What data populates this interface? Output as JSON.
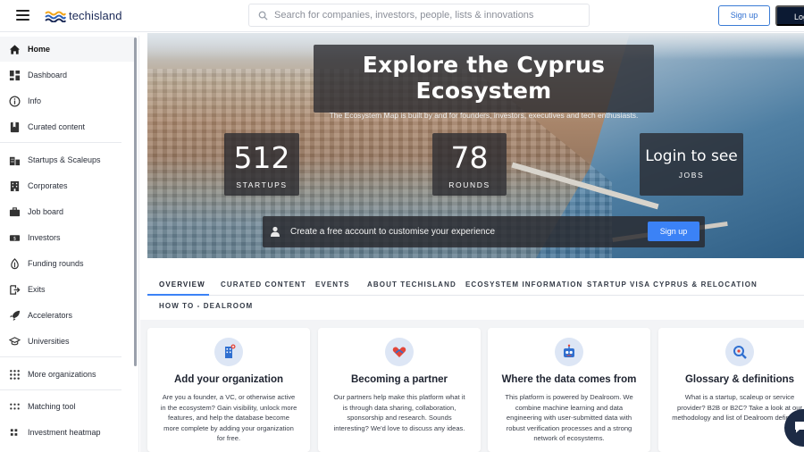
{
  "header": {
    "logo_text": "techisland",
    "search_placeholder": "Search for companies, investors, people, lists & innovations",
    "signup_label": "Sign up",
    "login_label": "Login"
  },
  "sidebar": {
    "items": [
      {
        "label": "Home",
        "icon": "home-icon"
      },
      {
        "label": "Dashboard",
        "icon": "dashboard-icon"
      },
      {
        "label": "Info",
        "icon": "info-icon"
      },
      {
        "label": "Curated content",
        "icon": "bookmark-icon"
      },
      {
        "label": "Startups & Scaleups",
        "icon": "building-icon"
      },
      {
        "label": "Corporates",
        "icon": "office-icon"
      },
      {
        "label": "Job board",
        "icon": "briefcase-icon"
      },
      {
        "label": "Investors",
        "icon": "money-icon"
      },
      {
        "label": "Funding rounds",
        "icon": "funding-icon"
      },
      {
        "label": "Exits",
        "icon": "exit-icon"
      },
      {
        "label": "Accelerators",
        "icon": "rocket-icon"
      },
      {
        "label": "Universities",
        "icon": "graduation-cap-icon"
      },
      {
        "label": "More organizations",
        "icon": "grid-icon"
      },
      {
        "label": "Matching tool",
        "icon": "matching-icon"
      },
      {
        "label": "Investment heatmap",
        "icon": "heatmap-icon"
      }
    ]
  },
  "hero": {
    "title": "Explore the Cyprus Ecosystem",
    "subtitle": "The Ecosystem Map is built by and for founders, investors, executives and tech enthusiasts.",
    "stats": [
      {
        "value": "512",
        "label": "STARTUPS"
      },
      {
        "value": "78",
        "label": "ROUNDS"
      }
    ],
    "login_box": {
      "title": "Login to see",
      "label": "JOBS"
    },
    "cta_text": "Create a free account to customise your experience",
    "cta_button": "Sign up"
  },
  "tabs": [
    "OVERVIEW",
    "CURATED CONTENT",
    "EVENTS",
    "ABOUT TECHISLAND",
    "ECOSYSTEM INFORMATION",
    "STARTUP VISA CYPRUS & RELOCATION",
    "HOW TO - DEALROOM"
  ],
  "cards": [
    {
      "title": "Add your organization",
      "body": "Are you a founder, a VC, or otherwise active in the ecosystem? Gain visibility, unlock more features, and help the database become more complete by adding your organization for free.",
      "icon": "building-add-icon"
    },
    {
      "title": "Becoming a partner",
      "body": "Our partners help make this platform what it is through data sharing, collaboration, sponsorship and research. Sounds interesting? We'd love to discuss any ideas.",
      "icon": "handshake-icon"
    },
    {
      "title": "Where the data comes from",
      "body": "This platform is powered by Dealroom. We combine machine learning and data engineering with user-submitted data with robust verification processes and a strong network of ecosystems.",
      "icon": "robot-icon"
    },
    {
      "title": "Glossary & definitions",
      "body": "What is a startup, scaleup or service provider? B2B or B2C? Take a look at our methodology and list of Dealroom definitions.",
      "icon": "magnifier-icon"
    }
  ],
  "colors": {
    "accent": "#3b82f6",
    "navy": "#0c1a33",
    "overlay": "#28282d"
  }
}
